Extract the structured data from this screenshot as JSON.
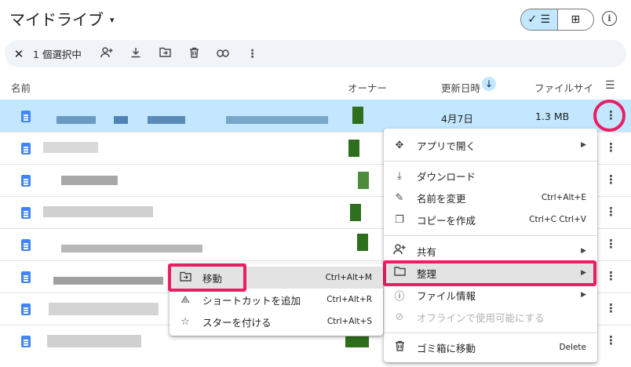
{
  "header": {
    "title": "マイドライブ",
    "caret": "▾",
    "view_list": "✓ ☰",
    "view_grid": "⊞",
    "info": "i"
  },
  "selection_bar": {
    "close": "✕",
    "count": "1 個選択中",
    "actions": [
      "share-icon",
      "download-icon",
      "move-icon",
      "trash-icon",
      "link-icon",
      "more-icon"
    ]
  },
  "columns": {
    "name": "名前",
    "owner": "オーナー",
    "modified": "更新日時",
    "size": "ファイルサイ",
    "sort_arrow": "↓",
    "sort_options": "☰"
  },
  "selected_row": {
    "modified": "4月7日",
    "size": "1.3 MB"
  },
  "context_menu": {
    "items": [
      {
        "icon": "✥",
        "label": "アプリで開く",
        "arrow": "▶"
      },
      {
        "icon": "⤓",
        "label": "ダウンロード"
      },
      {
        "icon": "✎",
        "label": "名前を変更",
        "shortcut": "Ctrl+Alt+E"
      },
      {
        "icon": "❐",
        "label": "コピーを作成",
        "shortcut": "Ctrl+C Ctrl+V"
      },
      {
        "icon": "⁺",
        "label": "共有",
        "arrow": "▶"
      },
      {
        "icon": "▭",
        "label": "整理",
        "arrow": "▶"
      },
      {
        "icon": "ⓘ",
        "label": "ファイル情報",
        "arrow": "▶"
      },
      {
        "icon": "⊘",
        "label": "オフラインで使用可能にする"
      },
      {
        "icon": "🗑",
        "label": "ゴミ箱に移動",
        "shortcut": "Delete"
      }
    ]
  },
  "submenu": {
    "items": [
      {
        "icon": "⇥",
        "label": "移動",
        "shortcut": "Ctrl+Alt+M"
      },
      {
        "icon": "⟁",
        "label": "ショートカットを追加",
        "shortcut": "Ctrl+Alt+R"
      },
      {
        "icon": "☆",
        "label": "スターを付ける",
        "shortcut": "Ctrl+Alt+S"
      }
    ]
  },
  "colors": {
    "selected_row": "#c2e7ff",
    "highlight": "#ea1e63",
    "doc_blue": "#4285f4",
    "owner_green": "#2e6f1d"
  }
}
